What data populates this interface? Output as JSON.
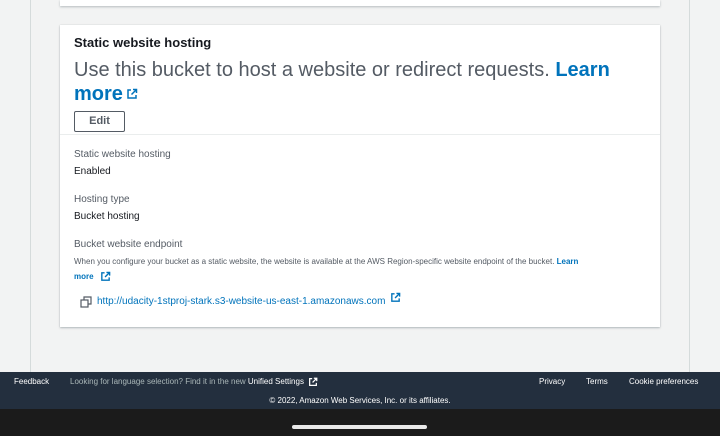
{
  "panel": {
    "title": "Static website hosting",
    "desc_text": "Use this bucket to host a website or redirect requests. ",
    "desc_learn_1": "Learn",
    "desc_learn_2": "more",
    "edit_label": "Edit"
  },
  "fields": {
    "hosting_label": "Static website hosting",
    "hosting_value": "Enabled",
    "type_label": "Hosting type",
    "type_value": "Bucket hosting",
    "endpoint_label": "Bucket website endpoint",
    "endpoint_help": "When you configure your bucket as a static website, the website is available at the AWS Region-specific website endpoint of the bucket. ",
    "endpoint_help_learn_1": "Learn",
    "endpoint_help_learn_2": "more",
    "endpoint_url": "http://udacity-1stproj-stark.s3-website-us-east-1.amazonaws.com"
  },
  "footer": {
    "feedback": "Feedback",
    "lang_prompt": "Looking for language selection? Find it in the new",
    "unified_settings": "Unified Settings",
    "privacy": "Privacy",
    "terms": "Terms",
    "cookies": "Cookie preferences",
    "copyright": "© 2022, Amazon Web Services, Inc. or its affiliates."
  },
  "icons": {
    "external": "external-link-icon",
    "copy": "copy-icon"
  },
  "colors": {
    "link": "#0073bb",
    "footer_bg": "#232f3e",
    "page_bg": "#f2f3f3"
  }
}
